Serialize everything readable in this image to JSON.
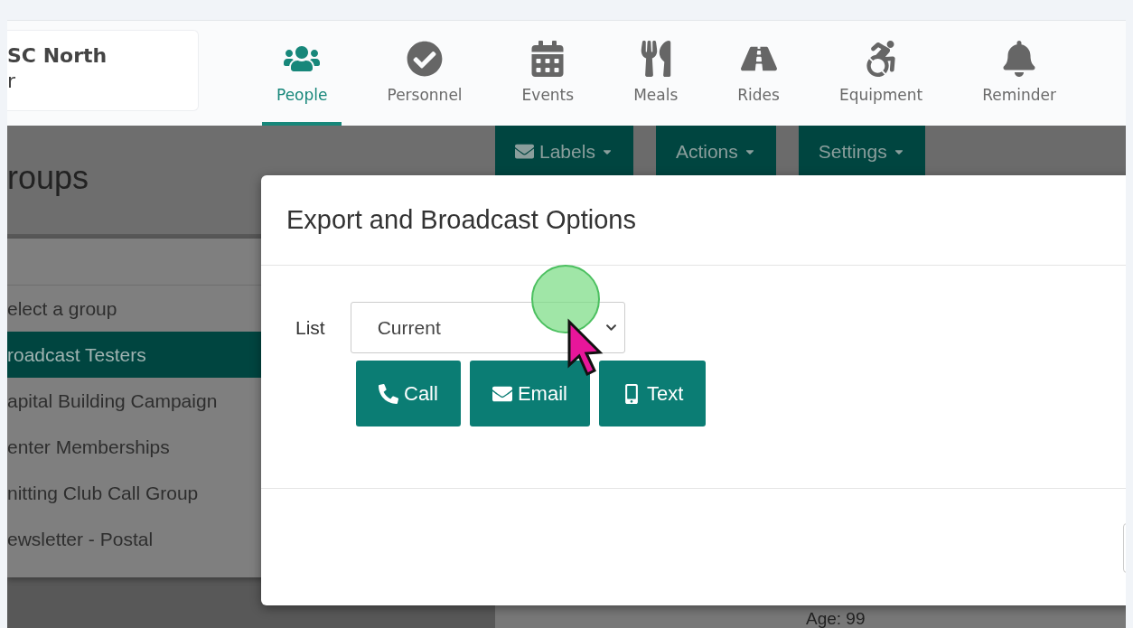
{
  "brand": {
    "line_1": "SC North",
    "line_2": "r"
  },
  "nav": [
    {
      "label": "People",
      "selected": true
    },
    {
      "label": "Personnel",
      "selected": false
    },
    {
      "label": "Events",
      "selected": false
    },
    {
      "label": "Meals",
      "selected": false
    },
    {
      "label": "Rides",
      "selected": false
    },
    {
      "label": "Equipment",
      "selected": false
    },
    {
      "label": "Reminder",
      "selected": false
    }
  ],
  "groups": {
    "title": "roups",
    "items": [
      {
        "label": "elect a group",
        "selected": false
      },
      {
        "label": "roadcast Testers",
        "selected": true
      },
      {
        "label": "apital Building Campaign",
        "selected": false
      },
      {
        "label": "enter Memberships",
        "selected": false
      },
      {
        "label": "nitting Club Call Group",
        "selected": false
      },
      {
        "label": "ewsletter - Postal",
        "selected": false
      }
    ]
  },
  "toolbar": [
    {
      "label": "Labels"
    },
    {
      "label": "Actions"
    },
    {
      "label": "Settings"
    }
  ],
  "detail": {
    "age": "Age: 99"
  },
  "modal": {
    "title": "Export and Broadcast Options",
    "list_label": "List",
    "list_value": "Current",
    "buttons": [
      {
        "label": "Call"
      },
      {
        "label": "Email"
      },
      {
        "label": "Text"
      }
    ]
  }
}
